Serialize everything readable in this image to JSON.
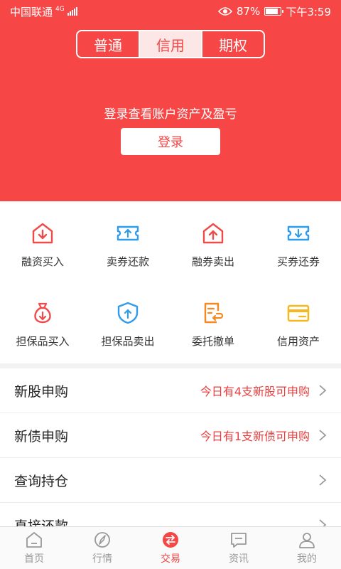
{
  "status": {
    "carrier": "中国联通",
    "network": "4G",
    "battery": "87%",
    "battery_level": 0.87,
    "time": "下午3:59"
  },
  "segment": {
    "tabs": [
      "普通",
      "信用",
      "期权"
    ],
    "active": "信用"
  },
  "login": {
    "tip": "登录查看账户资产及盈亏",
    "button": "登录"
  },
  "actions": [
    {
      "label": "融资买入",
      "icon": "house-arrow-down-icon",
      "color": "#f04b4b"
    },
    {
      "label": "卖券还款",
      "icon": "ticket-arrow-up-icon",
      "color": "#2f9cec"
    },
    {
      "label": "融券卖出",
      "icon": "house-arrow-up-icon",
      "color": "#f04b4b"
    },
    {
      "label": "买券还券",
      "icon": "ticket-arrow-down-icon",
      "color": "#2f9cec"
    },
    {
      "label": "担保品买入",
      "icon": "money-bag-icon",
      "color": "#f04b4b"
    },
    {
      "label": "担保品卖出",
      "icon": "shield-arrow-up-icon",
      "color": "#2f9cec"
    },
    {
      "label": "委托撤单",
      "icon": "undo-document-icon",
      "color": "#f5891f"
    },
    {
      "label": "信用资产",
      "icon": "credit-card-icon",
      "color": "#f5b81f"
    }
  ],
  "list": [
    {
      "title": "新股申购",
      "note": "今日有4支新股可申购"
    },
    {
      "title": "新债申购",
      "note": "今日有1支新债可申购"
    },
    {
      "title": "查询持仓",
      "note": ""
    },
    {
      "title": "直接还款",
      "note": ""
    }
  ],
  "tabbar": [
    {
      "label": "首页",
      "icon": "home-icon"
    },
    {
      "label": "行情",
      "icon": "compass-icon"
    },
    {
      "label": "交易",
      "icon": "exchange-icon",
      "active": true
    },
    {
      "label": "资讯",
      "icon": "message-icon"
    },
    {
      "label": "我的",
      "icon": "user-icon"
    }
  ]
}
